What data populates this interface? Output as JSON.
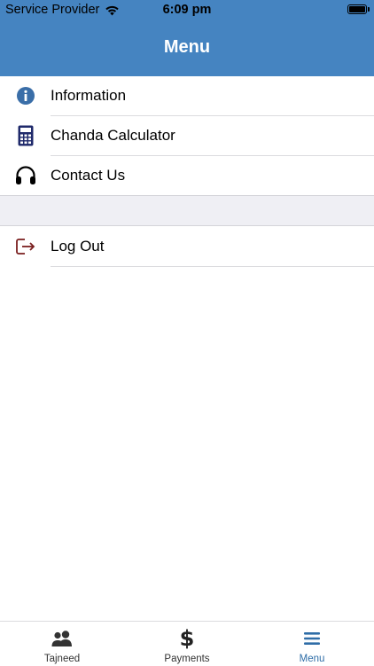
{
  "status_bar": {
    "carrier": "Service Provider",
    "time": "6:09 pm"
  },
  "header": {
    "title": "Menu"
  },
  "menu": {
    "items": [
      {
        "label": "Information",
        "icon": "info-icon"
      },
      {
        "label": "Chanda Calculator",
        "icon": "calculator-icon"
      },
      {
        "label": "Contact Us",
        "icon": "headphones-icon"
      }
    ],
    "logout": {
      "label": "Log Out",
      "icon": "logout-icon"
    }
  },
  "tabbar": {
    "tabs": [
      {
        "label": "Tajneed",
        "icon": "people-icon"
      },
      {
        "label": "Payments",
        "icon": "dollar-icon"
      },
      {
        "label": "Menu",
        "icon": "hamburger-icon",
        "active": true
      }
    ]
  },
  "colors": {
    "header_bg": "#4584c1",
    "info_icon": "#3a6ea8",
    "calculator_icon": "#1f2a6b",
    "logout_icon": "#7a1f1f",
    "active_tab": "#2f6da7"
  }
}
